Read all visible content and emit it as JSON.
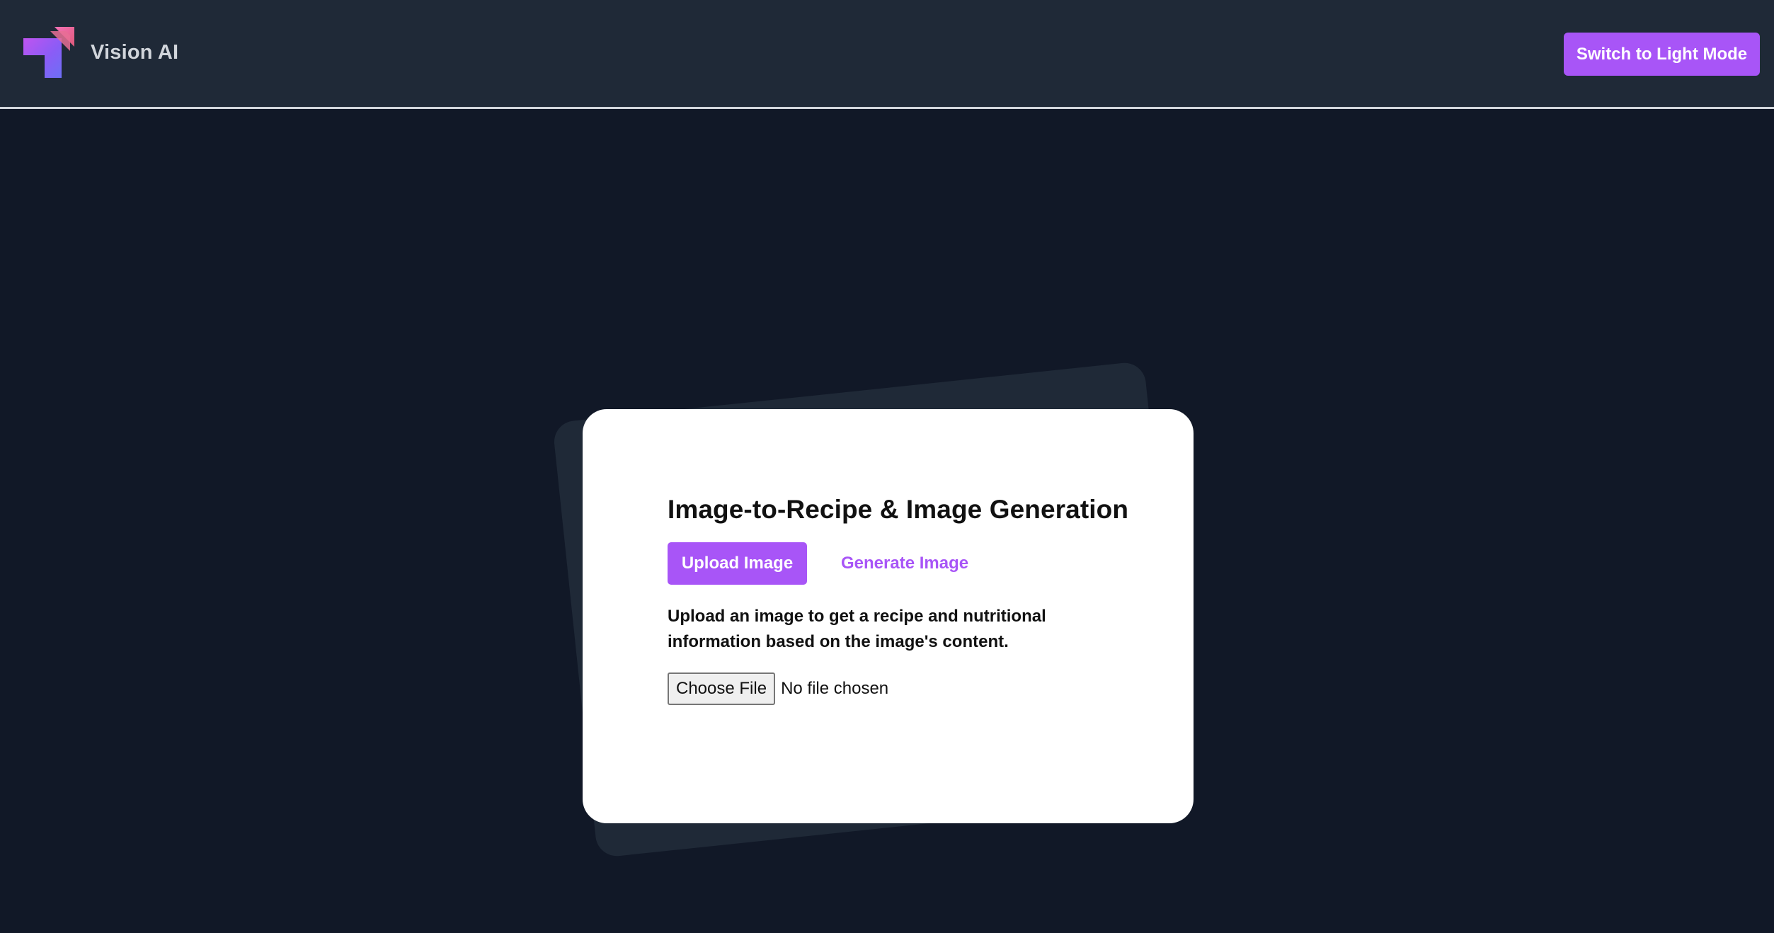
{
  "header": {
    "app_name": "Vision AI",
    "logo_icon": "vision-ai-logo",
    "theme_toggle_label": "Switch to Light Mode"
  },
  "card": {
    "title": "Image-to-Recipe & Image Generation",
    "tabs": [
      {
        "label": "Upload Image",
        "active": true
      },
      {
        "label": "Generate Image",
        "active": false
      }
    ],
    "description": "Upload an image to get a recipe and nutritional information based on the image's content.",
    "file_input": {
      "button_label": "Choose File",
      "status": "No file chosen"
    }
  },
  "colors": {
    "accent": "#a855f7",
    "page_bg": "#111827",
    "header_bg": "#1f2937",
    "card_bg": "#ffffff"
  }
}
